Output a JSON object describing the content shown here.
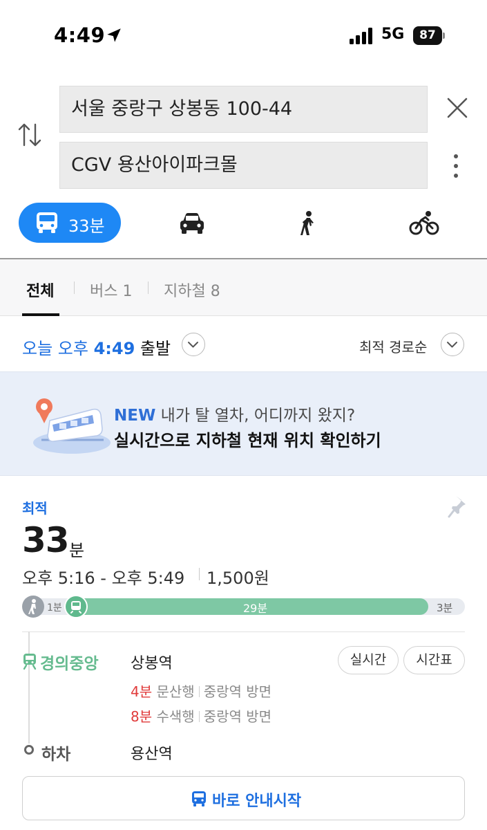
{
  "status_bar": {
    "time": "4:49",
    "network": "5G",
    "battery": "87"
  },
  "search": {
    "origin": "서울 중랑구 상봉동 100-44",
    "destination": "CGV 용산아이파크몰"
  },
  "modes": {
    "transit_label": "33분",
    "items": [
      "transit",
      "car",
      "walk",
      "bicycle"
    ],
    "active": "transit",
    "accent_color": "#1e88f5"
  },
  "tabs": [
    {
      "label": "전체",
      "active": true
    },
    {
      "label": "버스 1",
      "active": false
    },
    {
      "label": "지하철 8",
      "active": false
    }
  ],
  "depart": {
    "prefix": "오늘 오후 ",
    "time": "4:49",
    "suffix": " 출발",
    "sort": "최적 경로순"
  },
  "banner": {
    "new_tag": "NEW",
    "line1": " 내가 탈 열차, 어디까지 왔지?",
    "line2": "실시간으로 지하철 현재 위치 확인하기"
  },
  "route": {
    "label": "최적",
    "duration_number": "33",
    "duration_unit": "분",
    "time_range": "오후 5:16 - 오후 5:49",
    "fare": "1,500원",
    "segments": [
      {
        "type": "walk",
        "label": "1분"
      },
      {
        "type": "train",
        "label": "29분"
      },
      {
        "type": "walk",
        "label": "3분"
      }
    ],
    "line_name": "경의중앙",
    "line_color": "#66bb8f",
    "board_station": "상봉역",
    "realtime_chip": "실시간",
    "timetable_chip": "시간표",
    "arrivals": [
      {
        "minutes": "4분",
        "train": "문산행",
        "direction": "중랑역 방면"
      },
      {
        "minutes": "8분",
        "train": "수색행",
        "direction": "중랑역 방면"
      }
    ],
    "alight_label": "하차",
    "alight_station": "용산역",
    "start_button": "바로 안내시작"
  }
}
